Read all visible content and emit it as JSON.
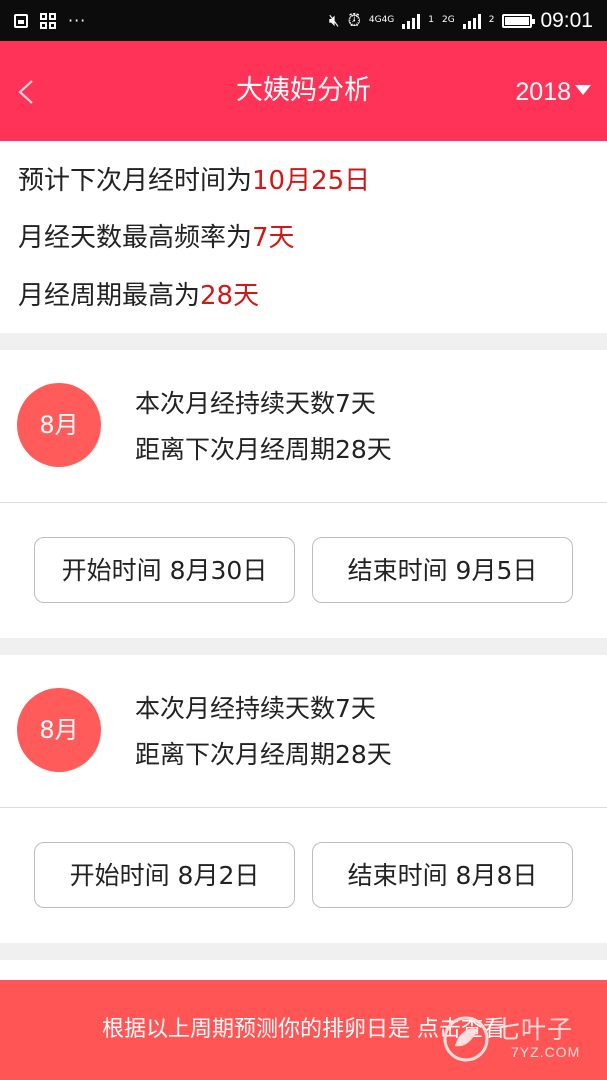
{
  "status_bar": {
    "left_icons": [
      "image-icon",
      "apps-icon"
    ],
    "more": "···",
    "right_icons": [
      "mute-icon",
      "alarm-icon",
      "signal-icon",
      "battery-icon"
    ],
    "net1": "4G",
    "net1b": "4G",
    "net2": "2G",
    "sim1": "1",
    "sim2": "2",
    "time": "09:01"
  },
  "header": {
    "title": "大姨妈分析",
    "year": "2018",
    "accent_color": "#ff3358"
  },
  "summary": {
    "line1_prefix": "预计下次月经时间为",
    "line1_value": "10月25日",
    "line2_prefix": "月经天数最高频率为",
    "line2_value": "7天",
    "line3_prefix": "月经周期最高为",
    "line3_value": "28天",
    "highlight_color": "#d01818"
  },
  "cycles": [
    {
      "month": "8月",
      "duration_text": "本次月经持续天数7天",
      "cycle_text": "距离下次月经周期28天",
      "start_label": "开始时间 8月30日",
      "end_label": "结束时间 9月5日"
    },
    {
      "month": "8月",
      "duration_text": "本次月经持续天数7天",
      "cycle_text": "距离下次月经周期28天",
      "start_label": "开始时间 8月2日",
      "end_label": "结束时间 8月8日"
    }
  ],
  "bottom_bar": {
    "text": "根据以上周期预测你的排卵日是 点击查看",
    "color": "#ff5555"
  },
  "watermark": {
    "text": "七叶子",
    "url": "7YZ.COM"
  }
}
